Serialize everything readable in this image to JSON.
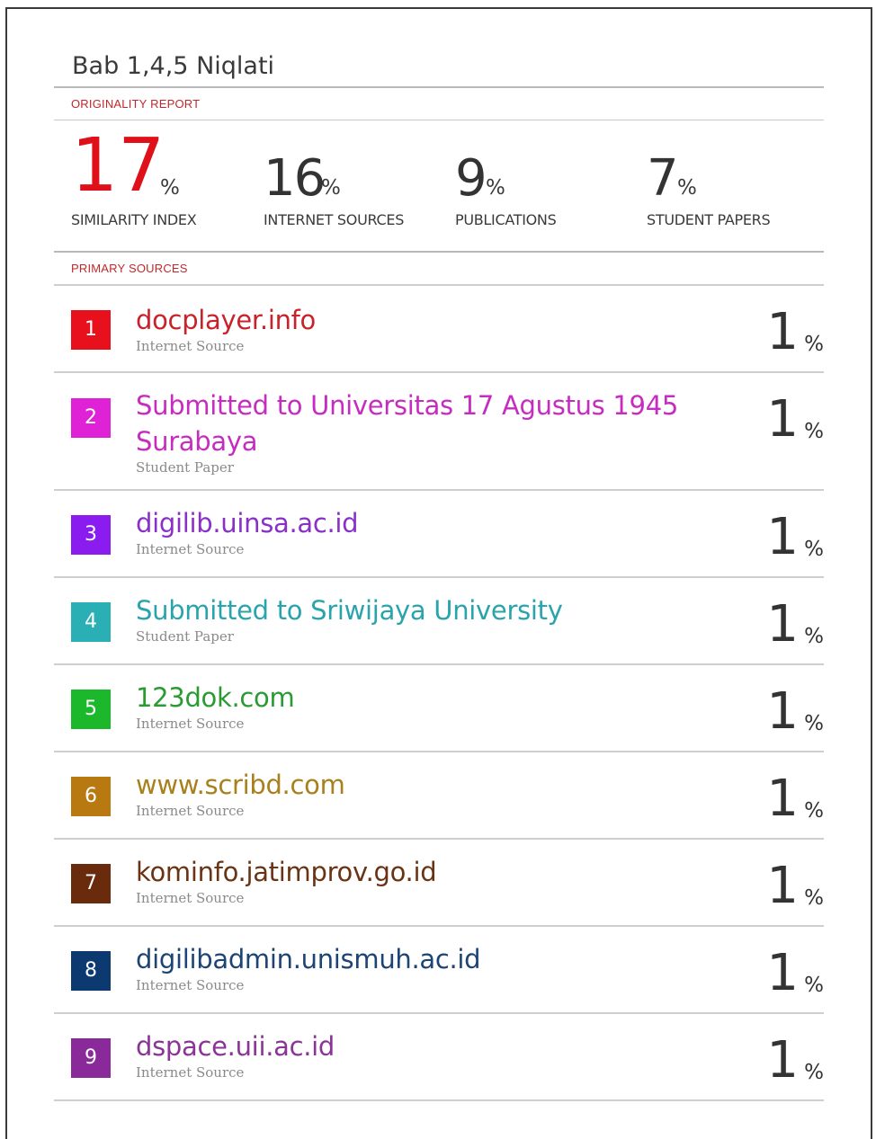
{
  "title": "Bab 1,4,5 Niqlati",
  "originality_label": "ORIGINALITY REPORT",
  "primary_sources_label": "PRIMARY SOURCES",
  "stats": [
    {
      "value": "17",
      "percent": "%",
      "caption": "SIMILARITY INDEX",
      "color": "#e0101a"
    },
    {
      "value": "16",
      "percent": "%",
      "caption": "INTERNET SOURCES",
      "color": "#333333"
    },
    {
      "value": "9",
      "percent": "%",
      "caption": "PUBLICATIONS",
      "color": "#333333"
    },
    {
      "value": "7",
      "percent": "%",
      "caption": "STUDENT PAPERS",
      "color": "#333333"
    }
  ],
  "sources": [
    {
      "rank": "1",
      "name": "docplayer.info",
      "type": "Internet Source",
      "percent": "1",
      "percent_sign": "%",
      "color": "#e8101c",
      "text_color": "#c8232b"
    },
    {
      "rank": "2",
      "name": "Submitted to Universitas 17 Agustus 1945 Surabaya",
      "type": "Student Paper",
      "percent": "1",
      "percent_sign": "%",
      "color": "#e022d6",
      "text_color": "#c62cc0"
    },
    {
      "rank": "3",
      "name": "digilib.uinsa.ac.id",
      "type": "Internet Source",
      "percent": "1",
      "percent_sign": "%",
      "color": "#8a1cf0",
      "text_color": "#8a30c8"
    },
    {
      "rank": "4",
      "name": "Submitted to Sriwijaya University",
      "type": "Student Paper",
      "percent": "1",
      "percent_sign": "%",
      "color": "#2ab0b4",
      "text_color": "#2aa4ac"
    },
    {
      "rank": "5",
      "name": "123dok.com",
      "type": "Internet Source",
      "percent": "1",
      "percent_sign": "%",
      "color": "#1cb82c",
      "text_color": "#2a9a32"
    },
    {
      "rank": "6",
      "name": "www.scribd.com",
      "type": "Internet Source",
      "percent": "1",
      "percent_sign": "%",
      "color": "#b87a10",
      "text_color": "#a8801c"
    },
    {
      "rank": "7",
      "name": "kominfo.jatimprov.go.id",
      "type": "Internet Source",
      "percent": "1",
      "percent_sign": "%",
      "color": "#6a2a0c",
      "text_color": "#6a3414"
    },
    {
      "rank": "8",
      "name": "digilibadmin.unismuh.ac.id",
      "type": "Internet Source",
      "percent": "1",
      "percent_sign": "%",
      "color": "#0c3a70",
      "text_color": "#1c4474"
    },
    {
      "rank": "9",
      "name": "dspace.uii.ac.id",
      "type": "Internet Source",
      "percent": "1",
      "percent_sign": "%",
      "color": "#8a2a9a",
      "text_color": "#8a3496"
    }
  ]
}
